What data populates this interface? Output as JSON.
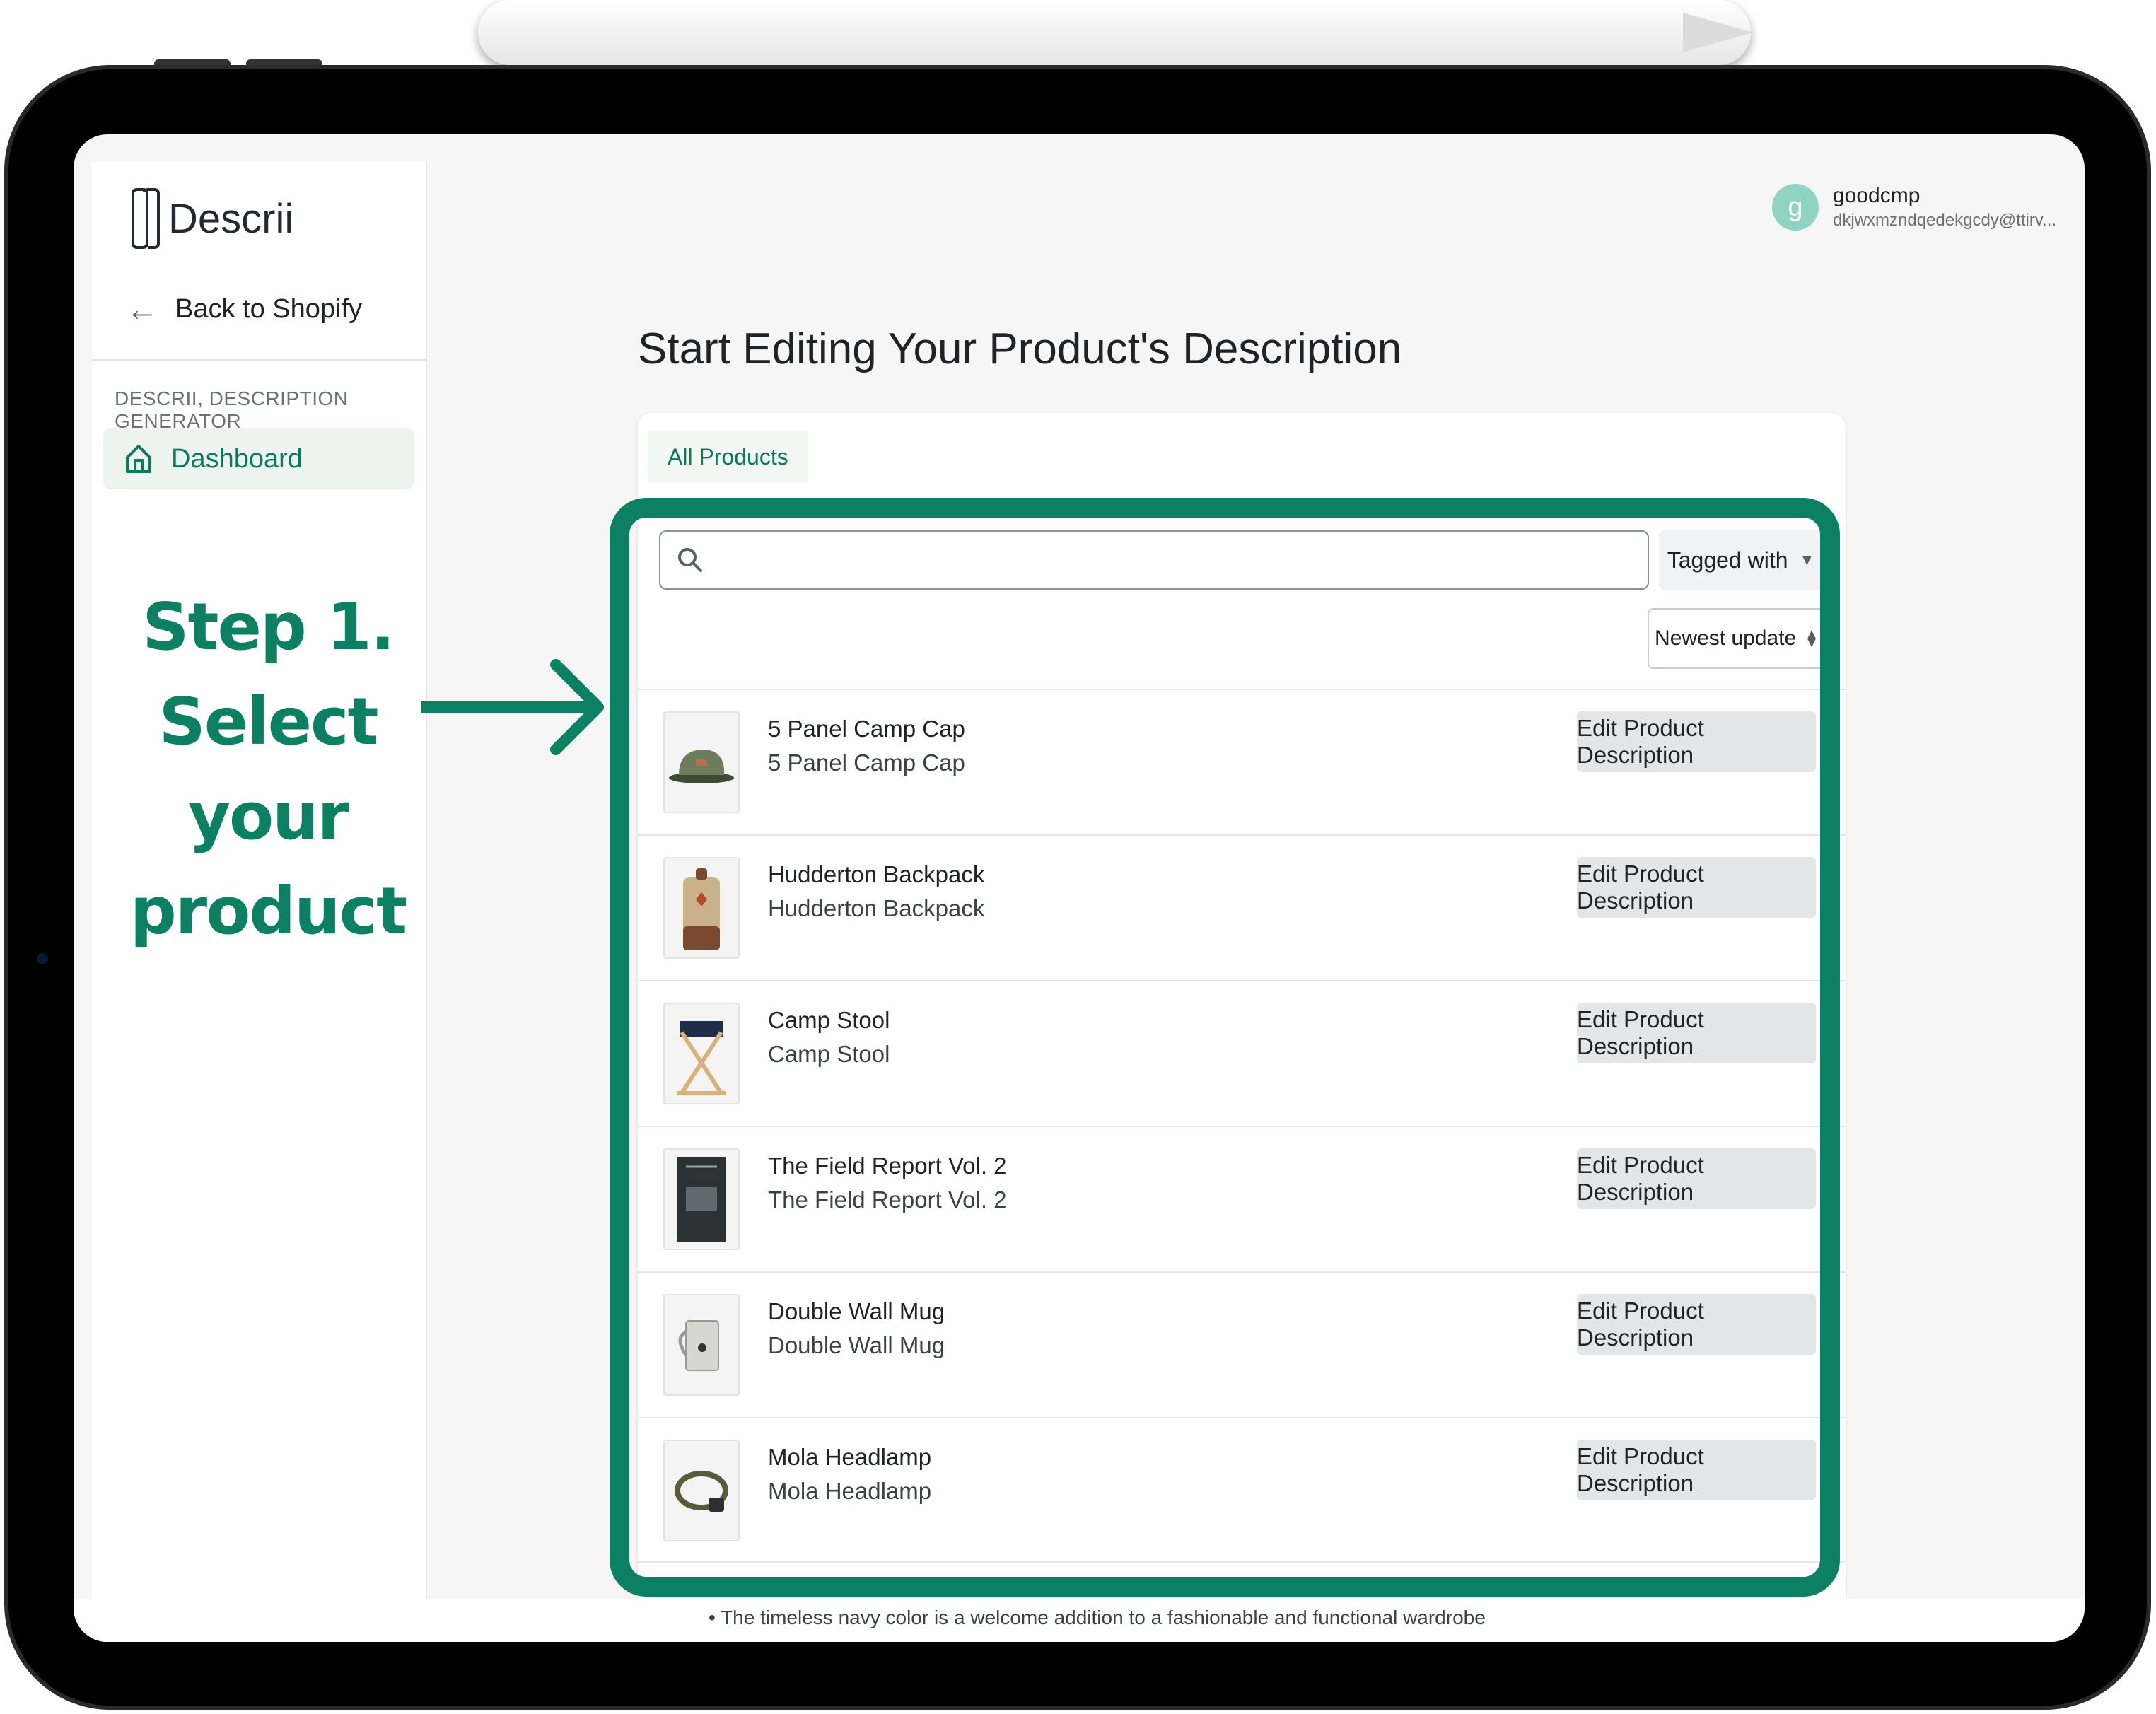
{
  "app": {
    "logo_text": "Descrii",
    "back_label": "Back to Shopify",
    "section_title": "DESCRII, DESCRIPTION GENERATOR",
    "nav_dashboard": "Dashboard"
  },
  "user": {
    "initial": "g",
    "name": "goodcmp",
    "email": "dkjwxmzndqedekgcdy@ttirv..."
  },
  "annotation": {
    "line1": "Step 1.",
    "line2": "Select your",
    "line3": "product"
  },
  "main": {
    "title": "Start Editing Your Product's Description",
    "tab": "All Products",
    "search_placeholder": "",
    "filter_label": "Tagged with",
    "sort_label": "Newest update"
  },
  "products": [
    {
      "title": "5 Panel Camp Cap",
      "subtitle": "5 Panel Camp Cap",
      "button": "Edit Product Description"
    },
    {
      "title": "Hudderton Backpack",
      "subtitle": "Hudderton Backpack",
      "button": "Edit Product Description"
    },
    {
      "title": "Camp Stool",
      "subtitle": "Camp Stool",
      "button": "Edit Product Description"
    },
    {
      "title": "The Field Report Vol. 2",
      "subtitle": "The Field Report Vol. 2",
      "button": "Edit Product Description"
    },
    {
      "title": "Double Wall Mug",
      "subtitle": "Double Wall Mug",
      "button": "Edit Product Description"
    },
    {
      "title": "Mola Headlamp",
      "subtitle": "Mola Headlamp",
      "button": "Edit Product Description"
    }
  ],
  "footer_text": "• The timeless navy color is a welcome addition to a fashionable and functional wardrobe",
  "colors": {
    "accent": "#0b8063",
    "nav_active": "#0a7a5a",
    "avatar": "#8fd3c2"
  },
  "icons": {
    "back": "arrow-left-icon",
    "dashboard": "home-icon",
    "search": "search-icon",
    "filter_caret": "caret-down-icon",
    "sort_caret": "sort-caret-icon",
    "callout_arrow": "arrow-right-icon"
  }
}
